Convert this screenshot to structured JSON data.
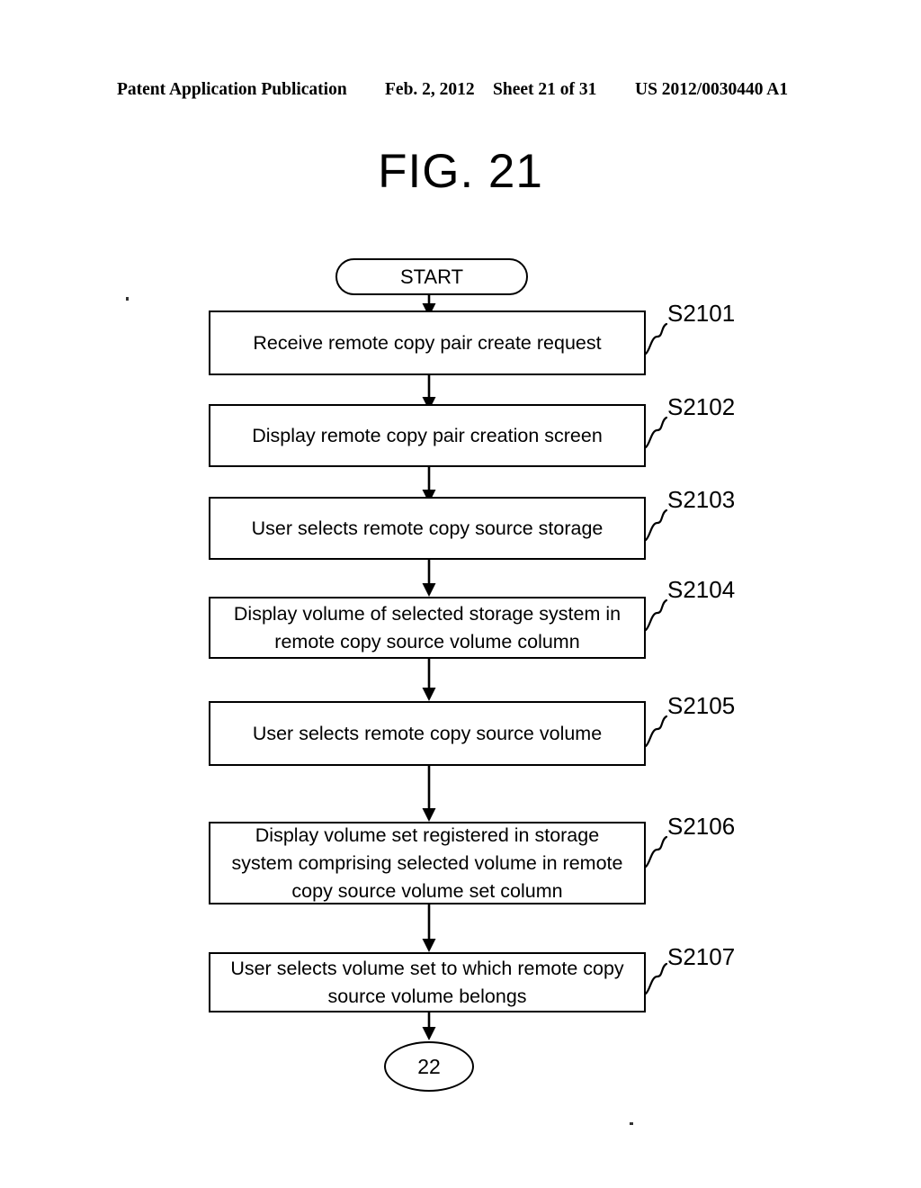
{
  "header": {
    "publication": "Patent Application Publication",
    "date": "Feb. 2, 2012",
    "sheet": "Sheet 21 of 31",
    "patent_number": "US 2012/0030440 A1"
  },
  "figure": {
    "title": "FIG. 21"
  },
  "flowchart": {
    "type": "flowchart",
    "orientation": "vertical",
    "start": {
      "shape": "stadium",
      "label": "START"
    },
    "end_connector": {
      "shape": "ellipse",
      "label": "22"
    },
    "steps": [
      {
        "id": "S2101",
        "text": "Receive remote copy pair create request",
        "lines": [
          "Receive remote copy pair create request"
        ]
      },
      {
        "id": "S2102",
        "text": "Display remote copy pair creation screen",
        "lines": [
          "Display remote copy pair creation screen"
        ]
      },
      {
        "id": "S2103",
        "text": "User selects remote copy source storage",
        "lines": [
          "User selects remote copy source storage"
        ]
      },
      {
        "id": "S2104",
        "text": "Display volume of selected storage system in remote copy source volume column",
        "lines": [
          "Display volume of selected storage system in",
          "remote copy source volume column"
        ]
      },
      {
        "id": "S2105",
        "text": "User selects remote copy source volume",
        "lines": [
          "User selects remote copy source volume"
        ]
      },
      {
        "id": "S2106",
        "text": "Display volume set registered in storage system comprising selected volume in remote copy source volume set column",
        "lines": [
          "Display volume set registered in storage",
          "system comprising selected volume in remote",
          "copy source volume set column"
        ]
      },
      {
        "id": "S2107",
        "text": "User selects volume set to which remote copy source volume belongs",
        "lines": [
          "User selects volume set to which remote copy",
          "source volume belongs"
        ]
      }
    ]
  },
  "colors": {
    "ink": "#000000",
    "paper": "#ffffff"
  }
}
